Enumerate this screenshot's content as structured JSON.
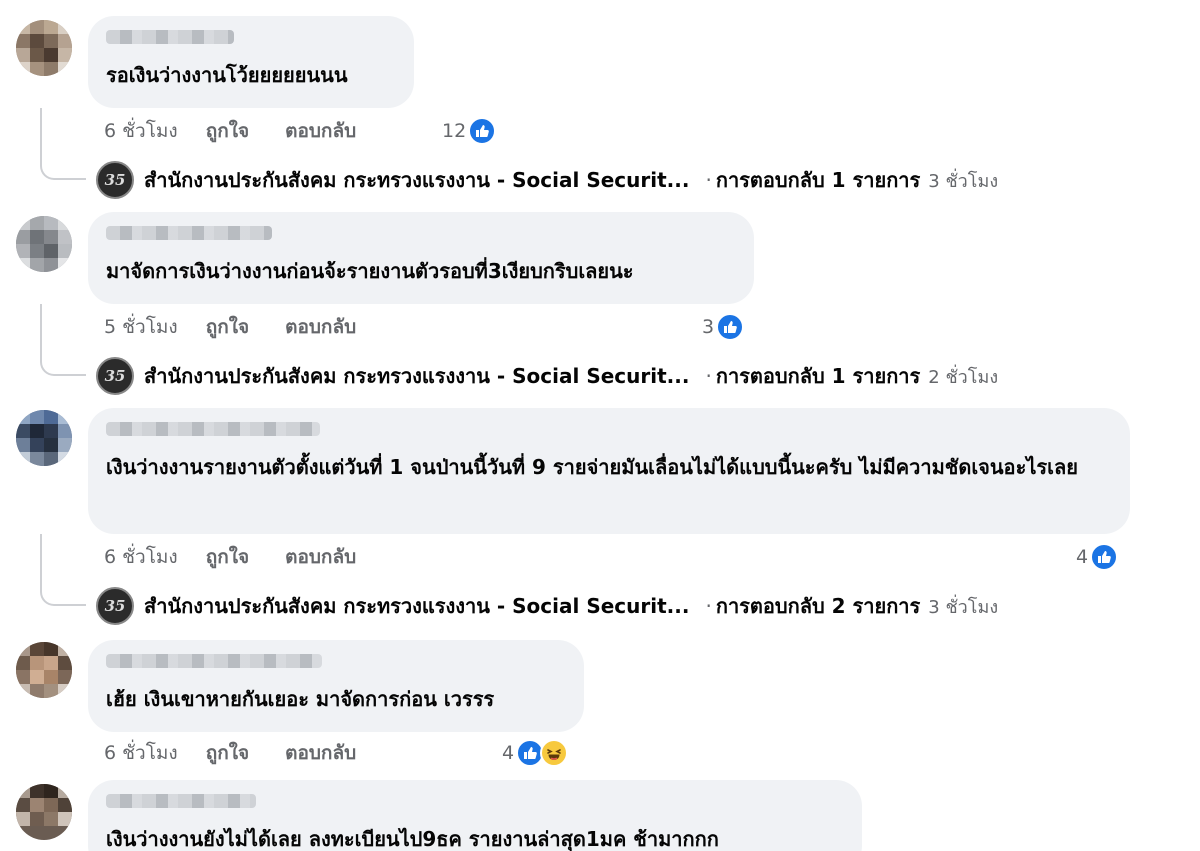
{
  "comments": [
    {
      "text": "รอเงินว่างงานโว้ยยยยยนนน",
      "time": "6 ชั่วโมง",
      "like_label": "ถูกใจ",
      "reply_label": "ตอบกลับ",
      "reaction_count": "12"
    },
    {
      "text": "มาจัดการเงินว่างงานก่อนจ้ะรายงานตัวรอบที่3เงียบกริบเลยนะ",
      "time": "5 ชั่วโมง",
      "like_label": "ถูกใจ",
      "reply_label": "ตอบกลับ",
      "reaction_count": "3"
    },
    {
      "text": "เงินว่างงานรายงานตัวตั้งแต่วันที่ 1 จนป่านนี้วันที่ 9 รายจ่ายมันเลื่อนไม่ได้แบบนี้นะครับ ไม่มีความชัดเจนอะไรเลย",
      "time": "6 ชั่วโมง",
      "like_label": "ถูกใจ",
      "reply_label": "ตอบกลับ",
      "reaction_count": "4"
    },
    {
      "text": "เฮ้ย เงินเขาหายกันเยอะ มาจัดการก่อน เวรรร",
      "time": "6 ชั่วโมง",
      "like_label": "ถูกใจ",
      "reply_label": "ตอบกลับ",
      "reaction_count": "4"
    },
    {
      "text": "เงินว่างงานยังไม่ได้เลย ลงทะเบียนไป9ธค รายงานล่าสุด1มค ช้ามากกก"
    }
  ],
  "replies": [
    {
      "page_name": "สำนักงานประกันสังคม กระทรวงแรงงาน - Social Securit...",
      "separator": "·",
      "reply_count": "การตอบกลับ 1 รายการ",
      "time": "3 ชั่วโมง"
    },
    {
      "page_name": "สำนักงานประกันสังคม กระทรวงแรงงาน - Social Securit...",
      "separator": "·",
      "reply_count": "การตอบกลับ 1 รายการ",
      "time": "2 ชั่วโมง"
    },
    {
      "page_name": "สำนักงานประกันสังคม กระทรวงแรงงาน - Social Securit...",
      "separator": "·",
      "reply_count": "การตอบกลับ 2 รายการ",
      "time": "3 ชั่วโมง"
    }
  ],
  "page_avatar_glyph": "35",
  "colors": {
    "bubble_bg": "#f0f2f5",
    "like_blue": "#1b74e4",
    "muted_text": "#65676b",
    "haha_yellow": "#f7c93e"
  },
  "icons": [
    "like-icon",
    "haha-icon",
    "page-avatar-icon"
  ]
}
